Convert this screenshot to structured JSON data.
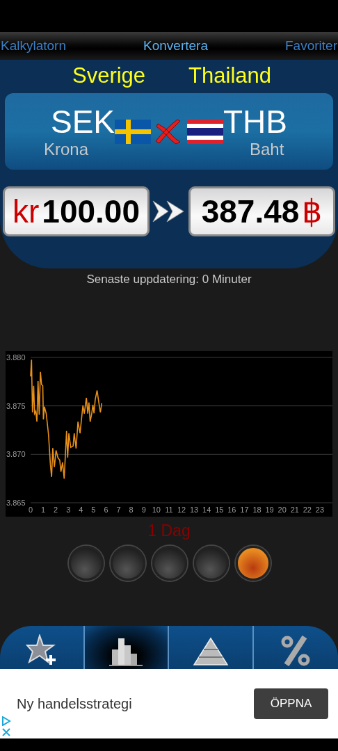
{
  "tabs": [
    {
      "label": "Kalkylatorn",
      "selected": false
    },
    {
      "label": "Konvertera",
      "selected": true
    },
    {
      "label": "Favoriter",
      "selected": false
    }
  ],
  "converter": {
    "currencies": [
      {
        "kind": "sweden",
        "country": "Sverige",
        "code": "SEK",
        "name": "Krona",
        "symbol": "kr",
        "amount": "100.00"
      },
      {
        "kind": "thailand",
        "country": "Thailand",
        "code": "THB",
        "name": "Baht",
        "symbol": "฿",
        "amount": "387.48"
      }
    ]
  },
  "last_update": "Senaste uppdatering: 0 Minuter",
  "chart": {
    "chart_data": {
      "type": "line",
      "xlim": [
        0,
        24
      ],
      "ylim": [
        3.865,
        3.88
      ],
      "yticks": [
        {
          "value": 3.865,
          "label": "3.865"
        },
        {
          "value": 3.87,
          "label": "3.870"
        },
        {
          "value": 3.875,
          "label": "3.875"
        },
        {
          "value": 3.88,
          "label": "3.880"
        }
      ],
      "xticks": [
        0,
        1,
        2,
        3,
        4,
        5,
        6,
        7,
        8,
        9,
        10,
        11,
        12,
        13,
        14,
        15,
        16,
        17,
        18,
        19,
        20,
        21,
        22,
        23
      ],
      "series": [
        {
          "color": "#e8901a",
          "x": [
            0,
            0.074,
            0.148,
            0.241,
            0.315,
            0.408,
            0.501,
            0.594,
            0.686,
            0.779,
            0.872,
            0.965,
            1.02,
            1.095,
            1.243,
            1.429,
            1.577,
            1.67,
            1.763,
            1.892,
            2.022,
            2.171,
            2.319,
            2.412,
            2.542,
            2.672,
            2.857,
            2.95,
            3.043,
            3.191,
            3.377,
            3.469,
            3.618,
            3.766,
            3.933,
            4.156,
            4.267,
            4.434,
            4.545,
            4.638,
            4.731,
            4.861,
            4.954,
            5.046,
            5.139,
            5.288,
            5.417,
            5.547,
            5.659
          ],
          "values": [
            3.87803,
            3.87976,
            3.87432,
            3.87707,
            3.8742,
            3.87444,
            3.87336,
            3.87755,
            3.87408,
            3.87851,
            3.8772,
            3.87707,
            3.8736,
            3.87492,
            3.8742,
            3.872,
            3.86892,
            3.86767,
            3.87065,
            3.86868,
            3.87041,
            3.86964,
            3.8694,
            3.8682,
            3.86916,
            3.86748,
            3.8724,
            3.86964,
            3.87216,
            3.87072,
            3.87084,
            3.87216,
            3.8706,
            3.87336,
            3.87216,
            3.87504,
            3.8742,
            3.87583,
            3.8742,
            3.87535,
            3.87336,
            3.8742,
            3.87511,
            3.87424,
            3.87564,
            3.87659,
            3.8754,
            3.87432,
            3.87528
          ]
        }
      ]
    }
  },
  "period_label": "1 Dag",
  "period_dots": [
    {
      "selected": false
    },
    {
      "selected": false
    },
    {
      "selected": false
    },
    {
      "selected": false
    },
    {
      "selected": true
    }
  ],
  "bottom_tabs": [
    {
      "kind": "favorite-add",
      "selected": false
    },
    {
      "kind": "chart",
      "selected": true
    },
    {
      "kind": "pyramid",
      "selected": false
    },
    {
      "kind": "percent",
      "selected": false
    }
  ],
  "ad": {
    "text": "Ny handelsstrategi",
    "button": "ÖPPNA"
  }
}
